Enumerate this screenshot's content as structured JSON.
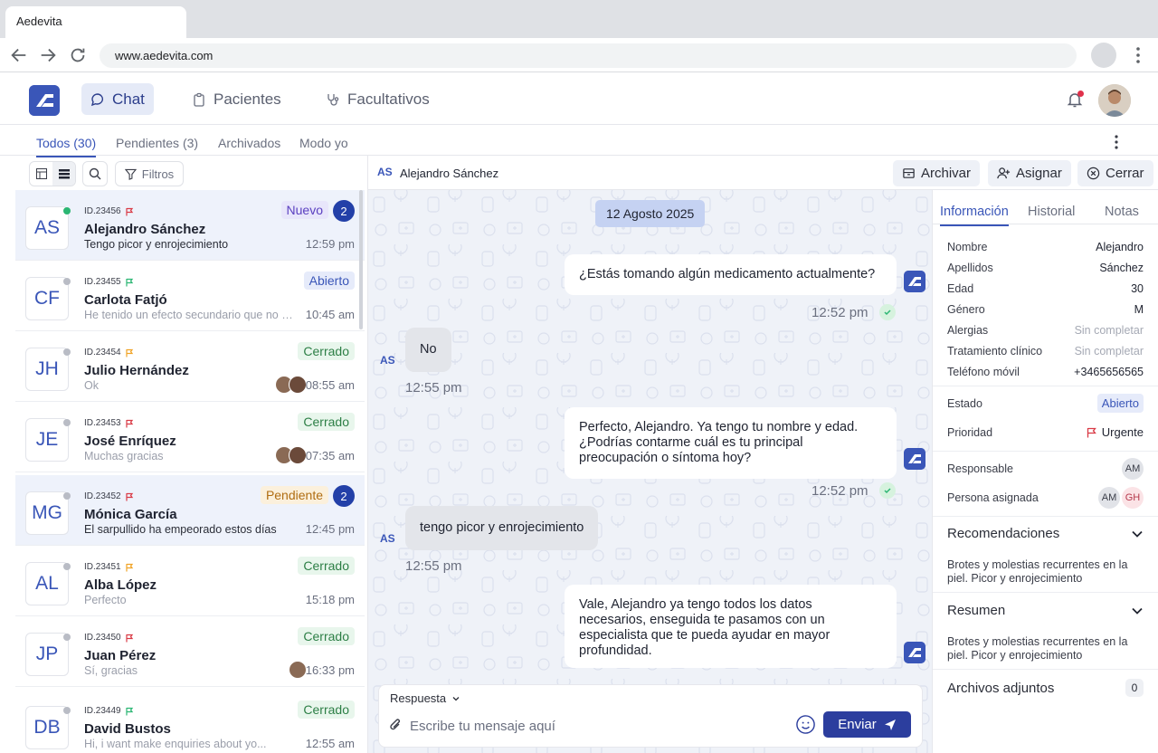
{
  "browser": {
    "tab_title": "Aedevita",
    "url": "www.aedevita.com"
  },
  "nav": {
    "items": [
      {
        "label": "Chat",
        "icon": "chat-bubble-icon"
      },
      {
        "label": "Pacientes",
        "icon": "clipboard-icon"
      },
      {
        "label": "Facultativos",
        "icon": "stethoscope-icon"
      }
    ]
  },
  "subtabs": [
    "Todos (30)",
    "Pendientes (3)",
    "Archivados",
    "Modo yo"
  ],
  "list_toolbar": {
    "filters_label": "Filtros"
  },
  "conversations": [
    {
      "initials": "AS",
      "id": "ID.23456",
      "name": "Alejandro Sánchez",
      "message": "Tengo picor y enrojecimiento",
      "time": "12:59 pm",
      "badge": "Nuevo",
      "count": "2"
    },
    {
      "initials": "CF",
      "id": "ID.23455",
      "name": "Carlota Fatjó",
      "message": "He tenido un efecto secundario que no me...",
      "time": "10:45 am",
      "badge": "Abierto"
    },
    {
      "initials": "JH",
      "id": "ID.23454",
      "name": "Julio Hernández",
      "message": "Ok",
      "time": "08:55 am",
      "badge": "Cerrado"
    },
    {
      "initials": "JE",
      "id": "ID.23453",
      "name": "José Enríquez",
      "message": "Muchas gracias",
      "time": "07:35 am",
      "badge": "Cerrado"
    },
    {
      "initials": "MG",
      "id": "ID.23452",
      "name": "Mónica García",
      "message": "El sarpullido ha empeorado estos días",
      "time": "12:45 pm",
      "badge": "Pendiente",
      "count": "2"
    },
    {
      "initials": "AL",
      "id": "ID.23451",
      "name": "Alba López",
      "message": "Perfecto",
      "time": "15:18 pm",
      "badge": "Cerrado"
    },
    {
      "initials": "JP",
      "id": "ID.23450",
      "name": "Juan Pérez",
      "message": "Sí, gracias",
      "time": "16:33 pm",
      "badge": "Cerrado"
    },
    {
      "initials": "DB",
      "id": "ID.23449",
      "name": "David Bustos",
      "message": "Hi, i want make enquiries about yo...",
      "time": "12:55 am",
      "badge": "Cerrado"
    }
  ],
  "chat": {
    "initials": "AS",
    "name": "Alejandro Sánchez",
    "actions": {
      "archive": "Archivar",
      "assign": "Asignar",
      "close": "Cerrar"
    },
    "date": "12 Agosto 2025",
    "messages": [
      {
        "text": "¿Estás tomando algún medicamento actualmente?",
        "time": "12:52 pm"
      },
      {
        "text": "No",
        "time": "12:55 pm"
      },
      {
        "text": "Perfecto, Alejandro. Ya tengo tu nombre y edad. ¿Podrías contarme cuál es tu principal preocupación o síntoma hoy?",
        "time": "12:52 pm"
      },
      {
        "text": "tengo picor y enrojecimiento",
        "time": "12:55 pm"
      },
      {
        "text": "Vale, Alejandro ya tengo todos los datos necesarios, enseguida te pasamos con un especialista que te pueda ayudar en mayor profundidad.",
        "time": ""
      }
    ],
    "composer": {
      "mode": "Respuesta",
      "placeholder": "Escribe tu mensaje aquí",
      "send": "Enviar"
    }
  },
  "info": {
    "tabs": [
      "Información",
      "Historial",
      "Notas"
    ],
    "fields": [
      {
        "k": "Nombre",
        "v": "Alejandro"
      },
      {
        "k": "Apellidos",
        "v": "Sánchez"
      },
      {
        "k": "Edad",
        "v": "30"
      },
      {
        "k": "Género",
        "v": "M"
      },
      {
        "k": "Alergias",
        "v": "Sin completar"
      },
      {
        "k": "Tratamiento clínico",
        "v": "Sin completar"
      },
      {
        "k": "Teléfono móvil",
        "v": "+3465656565"
      }
    ],
    "estado_label": "Estado",
    "estado_value": "Abierto",
    "prioridad_label": "Prioridad",
    "prioridad_value": "Urgente",
    "responsable_label": "Responsable",
    "responsable_value": "AM",
    "asignada_label": "Persona asignada",
    "asignada_values": [
      "AM",
      "GH"
    ],
    "recomendaciones_title": "Recomendaciones",
    "recomendaciones_text": "Brotes y molestias recurrentes en la piel. Picor y enrojecimiento",
    "resumen_title": "Resumen",
    "resumen_text": "Brotes y molestias recurrentes en la piel. Picor y enrojecimiento",
    "adjuntos_title": "Archivos adjuntos",
    "adjuntos_count": "0"
  },
  "colors": {
    "brand": "#3a56b8",
    "send": "#2c3e9e",
    "online": "#2bb673",
    "flag_red": "#d93a45",
    "flag_green": "#2bb673",
    "flag_orange": "#f0a326"
  }
}
